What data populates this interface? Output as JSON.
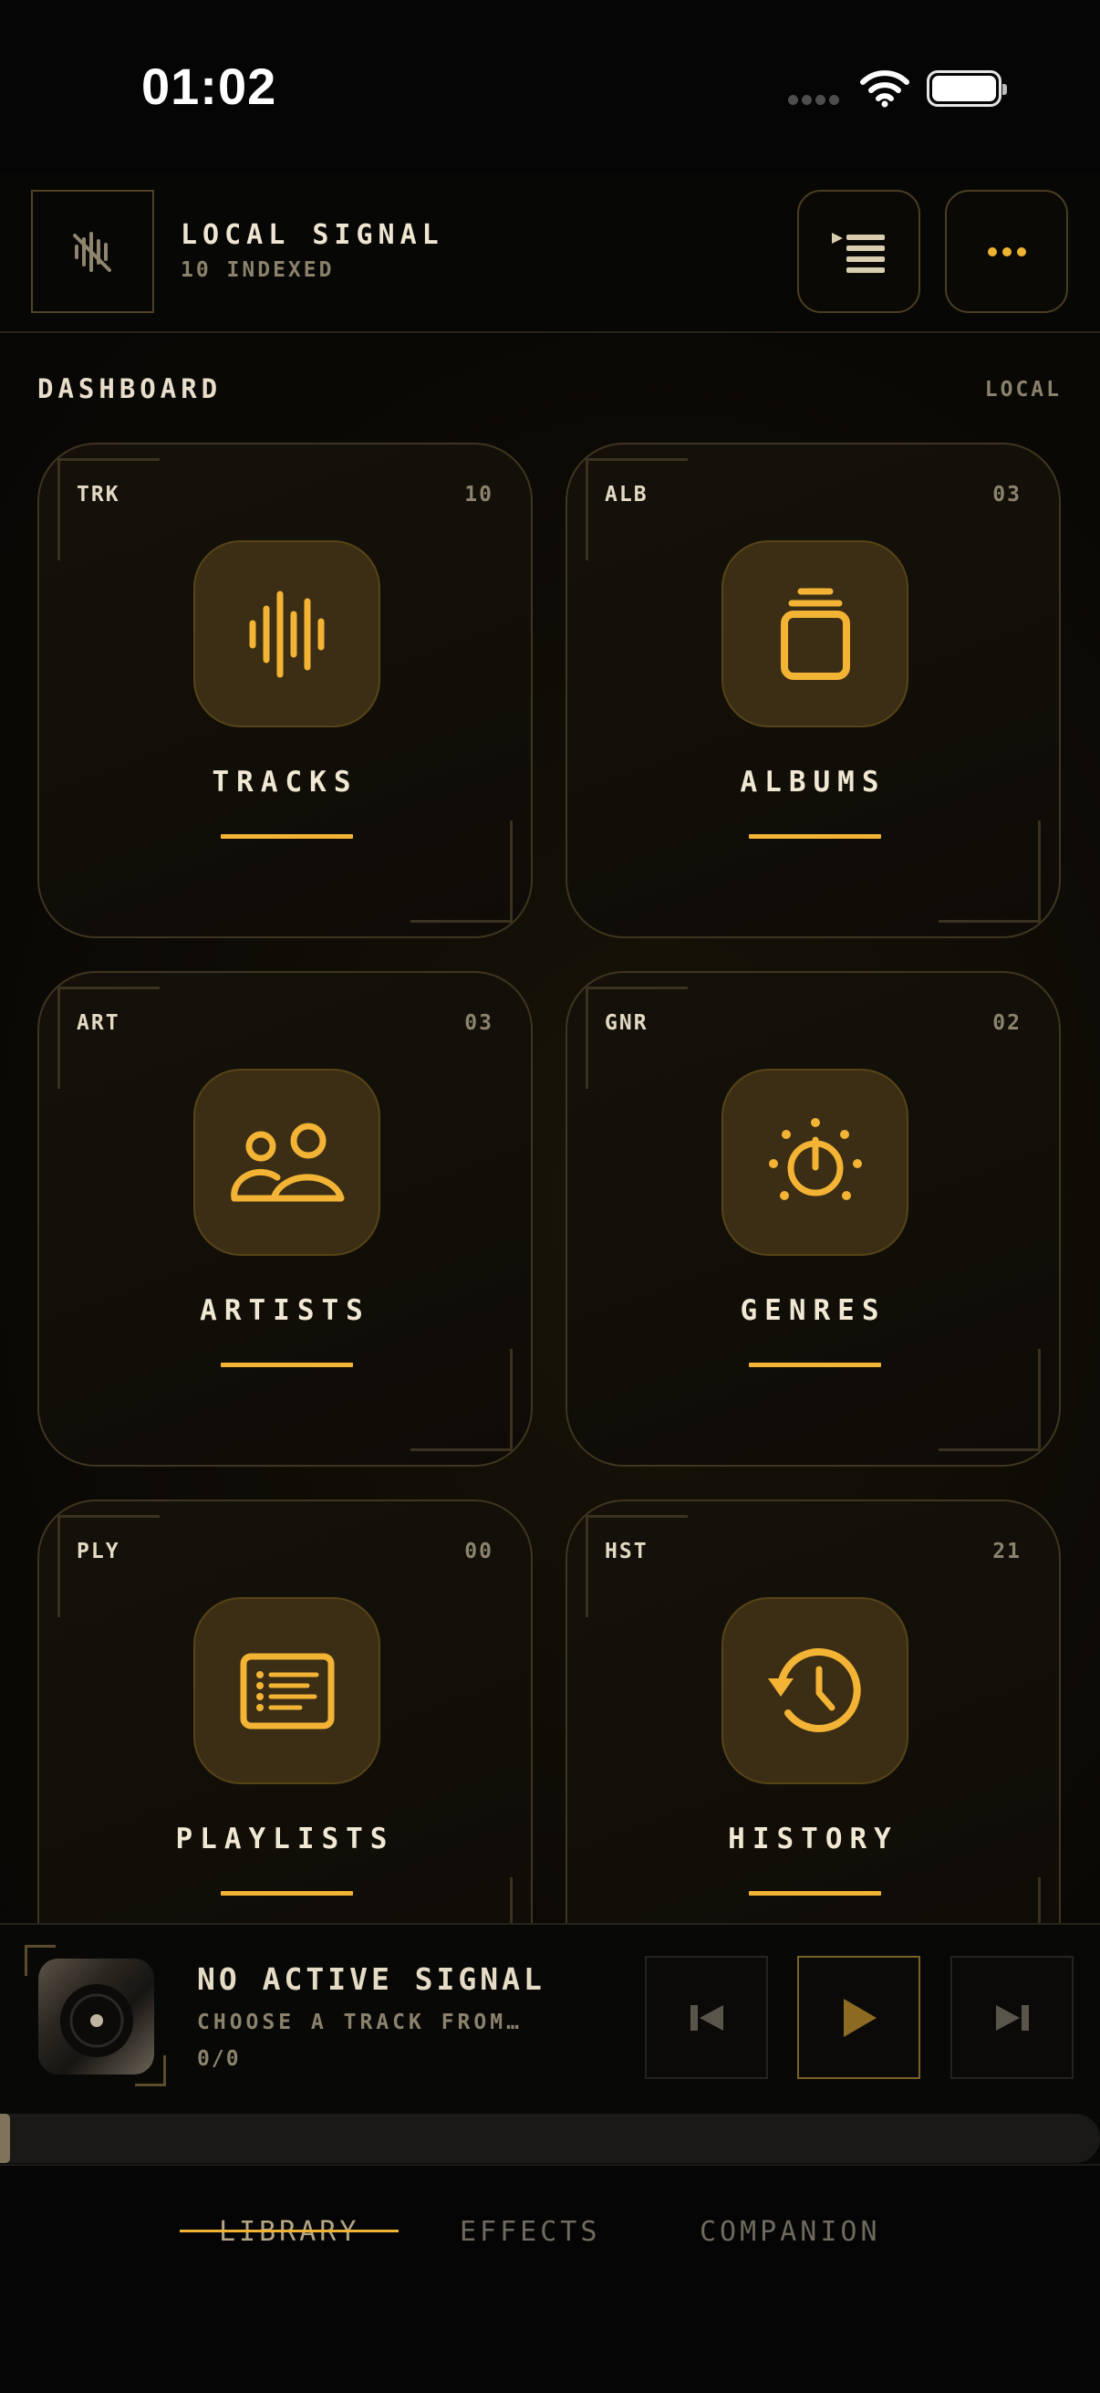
{
  "status_bar": {
    "time": "01:02"
  },
  "header": {
    "app_title": "LOCAL SIGNAL",
    "indexed_label": "10 INDEXED",
    "icons": {
      "logo": "muted-waveform-icon",
      "queue": "queue-list-icon",
      "more": "more-dots-icon"
    }
  },
  "dashboard": {
    "title": "DASHBOARD",
    "tag": "LOCAL",
    "cards": [
      {
        "code": "TRK",
        "count": "10",
        "label": "TRACKS",
        "icon": "waveform-icon"
      },
      {
        "code": "ALB",
        "count": "03",
        "label": "ALBUMS",
        "icon": "album-stack-icon"
      },
      {
        "code": "ART",
        "count": "03",
        "label": "ARTISTS",
        "icon": "people-icon"
      },
      {
        "code": "GNR",
        "count": "02",
        "label": "GENRES",
        "icon": "dial-sun-icon"
      },
      {
        "code": "PLY",
        "count": "00",
        "label": "PLAYLISTS",
        "icon": "playlist-card-icon"
      },
      {
        "code": "HST",
        "count": "21",
        "label": "HISTORY",
        "icon": "history-clock-icon"
      }
    ]
  },
  "now_playing": {
    "title": "NO ACTIVE SIGNAL",
    "subtitle": "CHOOSE A TRACK FROM…",
    "time": "0/0",
    "progress": 0,
    "controls": {
      "prev": "skip-back-icon",
      "play": "play-icon",
      "next": "skip-forward-icon"
    }
  },
  "tabs": [
    {
      "label": "LIBRARY",
      "active": true
    },
    {
      "label": "EFFECTS",
      "active": false
    },
    {
      "label": "COMPANION",
      "active": false
    }
  ],
  "colors": {
    "accent": "#f3b334",
    "background": "#050505",
    "card_border": "#3f3520",
    "icon_tile": "#3b2e14"
  }
}
